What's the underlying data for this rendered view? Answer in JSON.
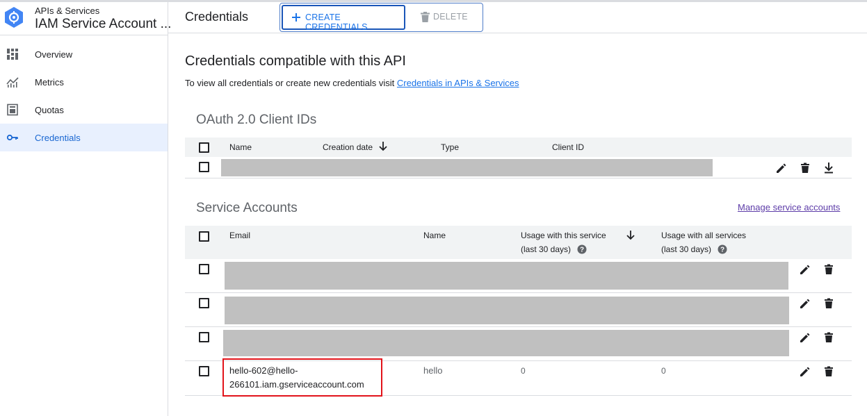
{
  "app": {
    "subtitle": "APIs & Services",
    "title": "IAM Service Account ..."
  },
  "sidebar": {
    "items": [
      {
        "label": "Overview",
        "icon": "dashboard-icon",
        "active": false
      },
      {
        "label": "Metrics",
        "icon": "metrics-icon",
        "active": false
      },
      {
        "label": "Quotas",
        "icon": "quotas-icon",
        "active": false
      },
      {
        "label": "Credentials",
        "icon": "key-icon",
        "active": true
      }
    ]
  },
  "header": {
    "title": "Credentials",
    "create_label": "CREATE CREDENTIALS",
    "delete_label": "DELETE"
  },
  "main": {
    "heading": "Credentials compatible with this API",
    "intro_text": "To view all credentials or create new credentials visit ",
    "intro_link": "Credentials in APIs & Services"
  },
  "oauth": {
    "title": "OAuth 2.0 Client IDs",
    "columns": [
      "Name",
      "Creation date",
      "Type",
      "Client ID"
    ]
  },
  "service_accounts": {
    "title": "Service Accounts",
    "manage_link": "Manage service accounts",
    "columns": {
      "email": "Email",
      "name": "Name",
      "usage_service_line1": "Usage with this service",
      "usage_service_line2": "(last 30 days)",
      "usage_all_line1": "Usage with all services",
      "usage_all_line2": "(last 30 days)"
    },
    "visible_row": {
      "email_line1": "hello-602@hello-",
      "email_line2": "266101.iam.gserviceaccount.com",
      "name": "hello",
      "usage_service": "0",
      "usage_all": "0"
    }
  },
  "colors": {
    "accent": "#1a73e8",
    "highlight": "#e2131a",
    "redaction": "#c0c0c0"
  }
}
